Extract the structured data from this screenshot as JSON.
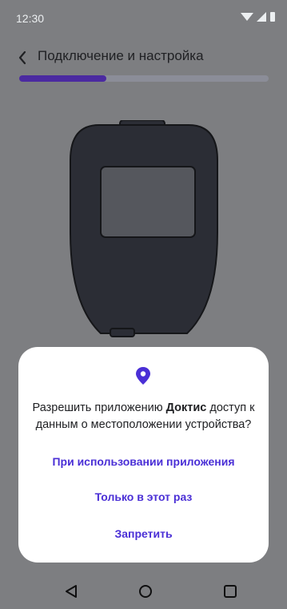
{
  "status_bar": {
    "time": "12:30",
    "icons": [
      "wifi-icon",
      "signal-icon",
      "battery-icon"
    ]
  },
  "header": {
    "back_icon": "chevron-left-icon",
    "title": "Подключение и настройка"
  },
  "progress": {
    "fraction": 0.35
  },
  "illustration": {
    "name": "glucometer-device"
  },
  "dialog": {
    "icon": "location-pin-icon",
    "message_prefix": "Разрешить приложению ",
    "app_name": "Доктис",
    "message_suffix": " доступ к данным о местоположении устройства?",
    "options": [
      "При использовании приложения",
      "Только в этот раз",
      "Запретить"
    ]
  },
  "nav_bar": {
    "icons": [
      "back-triangle-icon",
      "home-circle-icon",
      "recents-square-icon"
    ]
  },
  "colors": {
    "accent": "#4a2fd6",
    "scrim_background": "#7d7e81",
    "progress_fill": "#4b2aa0",
    "device_body": "#2b2d35"
  }
}
